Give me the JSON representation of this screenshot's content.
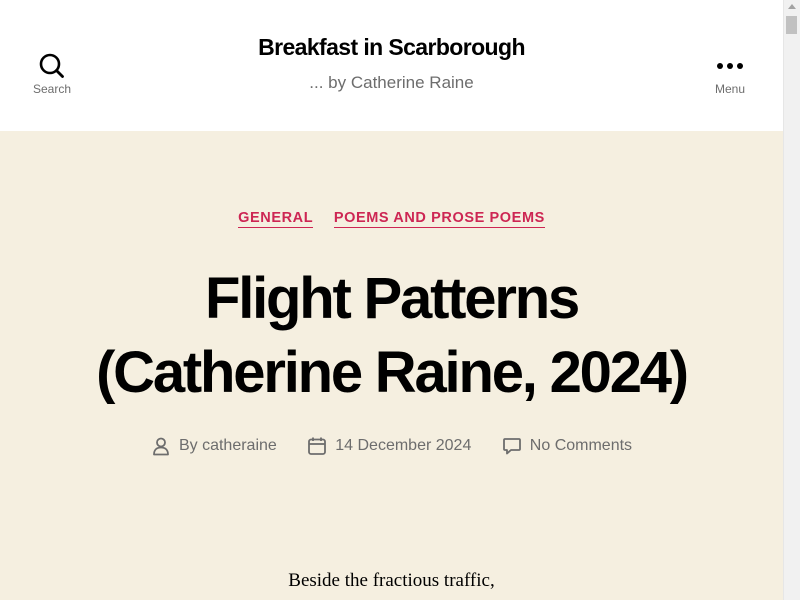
{
  "header": {
    "search_label": "Search",
    "menu_label": "Menu",
    "site_title": "Breakfast in Scarborough",
    "site_description": "... by Catherine Raine"
  },
  "entry": {
    "categories": [
      "GENERAL",
      "POEMS AND PROSE POEMS"
    ],
    "title_line1": "Flight Patterns",
    "title_line2": "(Catherine Raine, 2024)",
    "author_prefix": "By",
    "author": "catheraine",
    "date": "14 December 2024",
    "comments": "No Comments",
    "content_first_line": "Beside the fractious traffic,"
  },
  "icons": {
    "search": "search-icon",
    "menu": "menu-icon",
    "author": "user-icon",
    "date": "calendar-icon",
    "comments": "comment-icon"
  },
  "colors": {
    "accent": "#cd2653",
    "background": "#f5efe0",
    "header_bg": "#ffffff",
    "meta_text": "#6d6d6d",
    "title_text": "#000000"
  }
}
